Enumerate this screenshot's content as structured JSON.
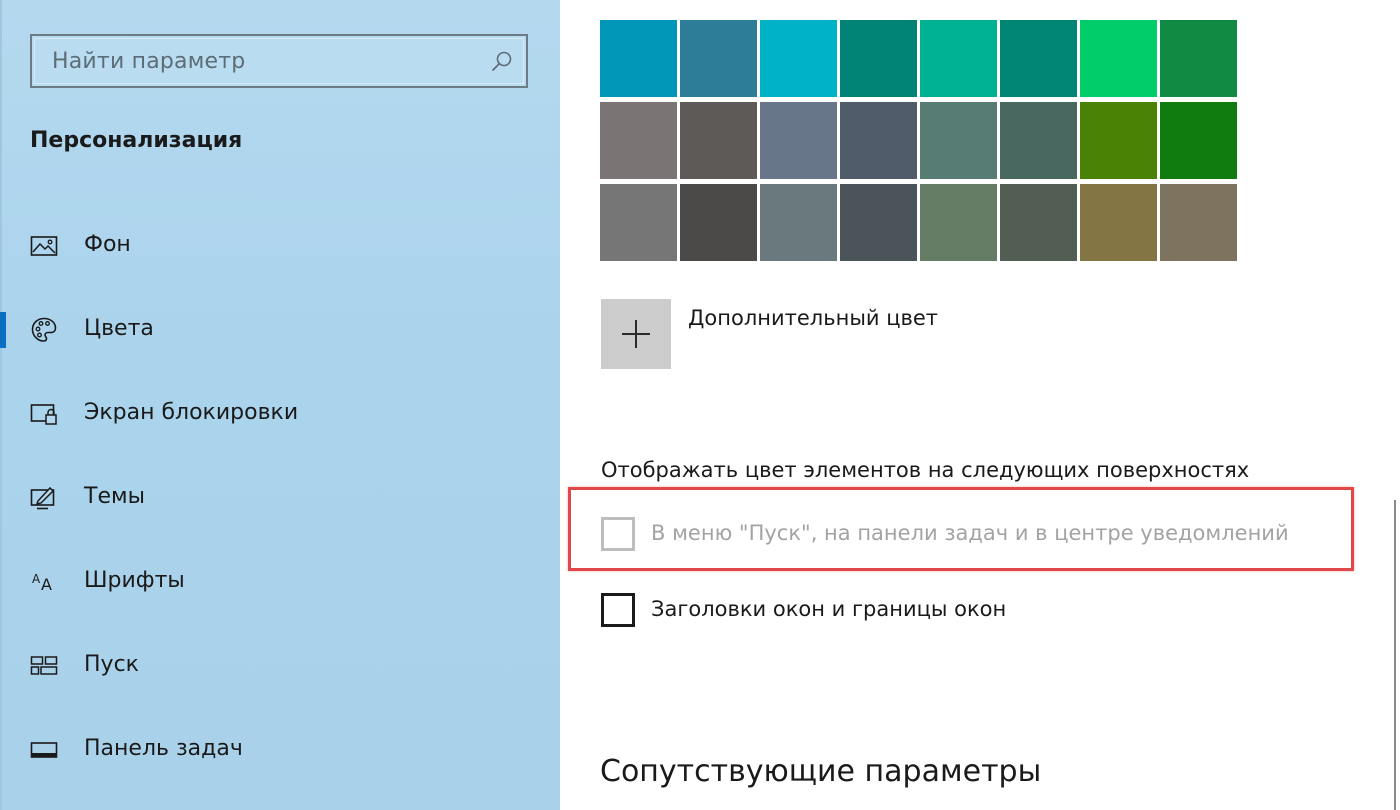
{
  "search": {
    "placeholder": "Найти параметр",
    "icon": "search-icon"
  },
  "sidebar": {
    "section_title": "Персонализация",
    "items": [
      {
        "label": "Фон",
        "icon": "image-icon",
        "active": false
      },
      {
        "label": "Цвета",
        "icon": "palette-icon",
        "active": true
      },
      {
        "label": "Экран блокировки",
        "icon": "lock-screen-icon",
        "active": false
      },
      {
        "label": "Темы",
        "icon": "themes-icon",
        "active": false
      },
      {
        "label": "Шрифты",
        "icon": "fonts-icon",
        "active": false
      },
      {
        "label": "Пуск",
        "icon": "start-icon",
        "active": false
      },
      {
        "label": "Панель задач",
        "icon": "taskbar-icon",
        "active": false
      }
    ]
  },
  "main": {
    "colors": {
      "swatches": [
        [
          "#0097b8",
          "#2e7d98",
          "#00b2c6",
          "#018376",
          "#00b294",
          "#018574",
          "#00cc6a",
          "#118a43"
        ],
        [
          "#7a7574",
          "#5d5a58",
          "#68768a",
          "#515c6b",
          "#567c73",
          "#486860",
          "#498205",
          "#107c10"
        ],
        [
          "#767676",
          "#4c4a48",
          "#69797e",
          "#4a5459",
          "#647c64",
          "#525e54",
          "#847545",
          "#7e735f"
        ]
      ]
    },
    "custom_color": {
      "label": "Дополнительный цвет"
    },
    "surfaces": {
      "heading": "Отображать цвет элементов на следующих поверхностях",
      "start_taskbar": {
        "label": "В меню \"Пуск\", на панели задач и в центре уведомлений",
        "checked": false,
        "disabled": true
      },
      "title_bars": {
        "label": "Заголовки окон и границы окон",
        "checked": false,
        "disabled": false
      }
    },
    "related_heading": "Сопутствующие параметры"
  },
  "accent": {
    "highlight_border": "#e0484a",
    "nav_active": "#0a6fc2"
  }
}
